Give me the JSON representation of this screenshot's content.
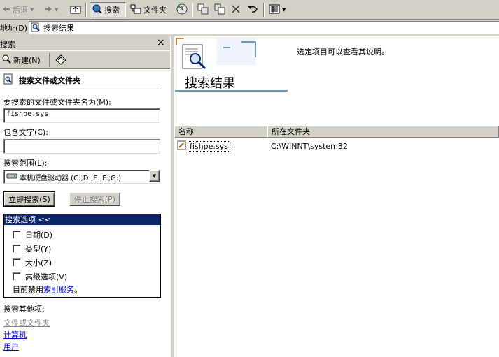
{
  "toolbar": {
    "back_label": "后退",
    "search_label": "搜索",
    "folders_label": "文件夹"
  },
  "address_bar": {
    "label": "地址(D)",
    "value": "搜索结果"
  },
  "search_pane": {
    "title": "搜索",
    "close_glyph": "×",
    "new_label": "新建(N)",
    "section_title": "搜索文件或文件夹",
    "filename_label": "要搜索的文件或文件夹名为(M):",
    "filename_value": "fishpe.sys",
    "containing_label": "包含文字(C):",
    "containing_value": "",
    "lookin_label": "搜索范围(L):",
    "lookin_value": "本机硬盘驱动器 (C:;D:;E:;F:;G:)",
    "search_now_label": "立即搜索(S)",
    "stop_label": "停止搜索(P)",
    "options_header": "搜索选项 <<",
    "options": [
      {
        "label": "日期(D)",
        "checked": false
      },
      {
        "label": "类型(Y)",
        "checked": false
      },
      {
        "label": "大小(Z)",
        "checked": false
      },
      {
        "label": "高级选项(V)",
        "checked": false
      }
    ],
    "index_text_prefix": "目前禁用",
    "index_link": "索引服务",
    "index_text_suffix": "。",
    "other_label": "搜索其他项:",
    "other_links": [
      "文件或文件夹",
      "计算机",
      "用户"
    ]
  },
  "results": {
    "description": "选定项目可以查看其说明。",
    "title": "搜索结果",
    "columns": [
      "名称",
      "所在文件夹"
    ],
    "rows": [
      {
        "name": "fishpe.sys",
        "folder": "C:\\WINNT\\system32"
      }
    ]
  },
  "colors": {
    "window_bg": "#d4d0c8",
    "selection_blue": "#0a246a",
    "link_blue": "#0000ff"
  },
  "icons": [
    "back-arrow-icon",
    "forward-arrow-icon",
    "up-folder-icon",
    "search-globe-icon",
    "folders-icon",
    "history-icon",
    "move-to-icon",
    "copy-to-icon",
    "delete-icon",
    "undo-icon",
    "views-icon",
    "search-doc-icon",
    "new-search-icon",
    "assistant-icon",
    "file-sys-icon",
    "magnifier-doc-icon"
  ]
}
